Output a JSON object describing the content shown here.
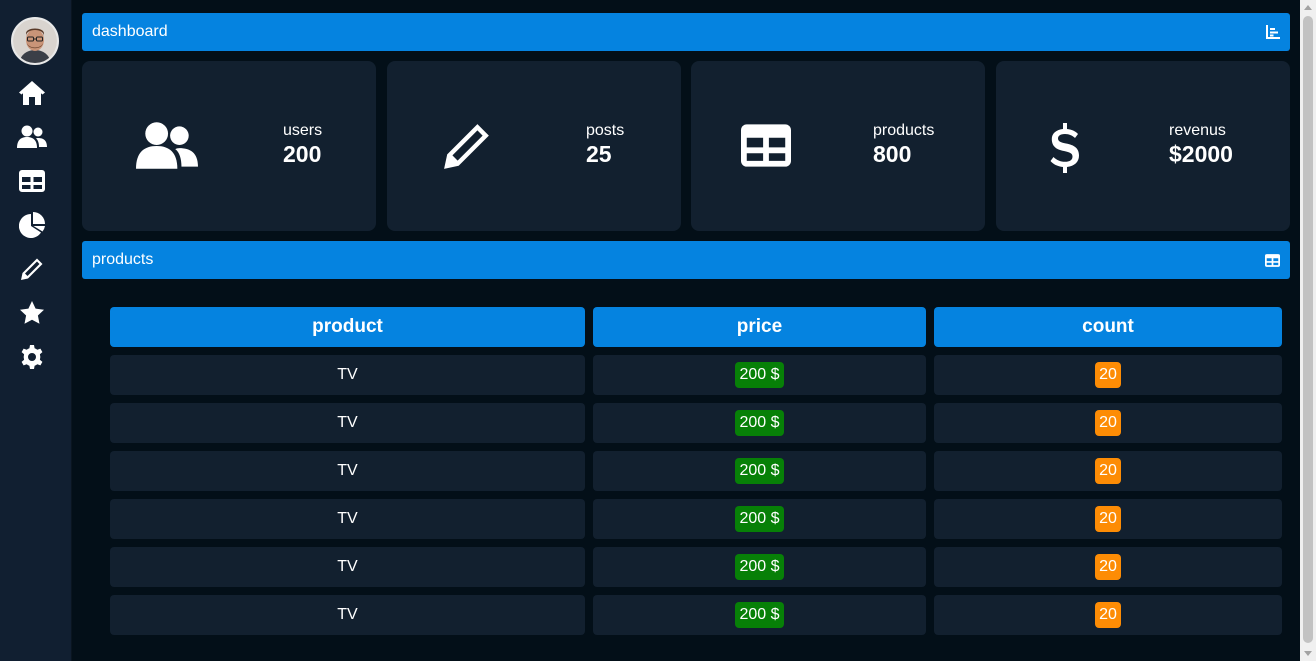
{
  "sidebar": {
    "avatar": "user-avatar",
    "items": [
      {
        "icon": "home-icon"
      },
      {
        "icon": "users-icon"
      },
      {
        "icon": "table-icon"
      },
      {
        "icon": "pie-chart-icon"
      },
      {
        "icon": "pencil-icon"
      },
      {
        "icon": "star-icon"
      },
      {
        "icon": "gear-icon"
      }
    ]
  },
  "dashboard_bar": {
    "title": "dashboard",
    "icon": "bar-chart-icon"
  },
  "stats": [
    {
      "label": "users",
      "value": "200",
      "icon": "users-icon"
    },
    {
      "label": "posts",
      "value": "25",
      "icon": "pencil-icon"
    },
    {
      "label": "products",
      "value": "800",
      "icon": "table-icon"
    },
    {
      "label": "revenus",
      "value": "$2000",
      "icon": "dollar-icon"
    }
  ],
  "products_bar": {
    "title": "products",
    "icon": "table-icon"
  },
  "table": {
    "headers": [
      "product",
      "price",
      "count"
    ],
    "rows": [
      {
        "product": "TV",
        "price": "200 $",
        "count": "20"
      },
      {
        "product": "TV",
        "price": "200 $",
        "count": "20"
      },
      {
        "product": "TV",
        "price": "200 $",
        "count": "20"
      },
      {
        "product": "TV",
        "price": "200 $",
        "count": "20"
      },
      {
        "product": "TV",
        "price": "200 $",
        "count": "20"
      },
      {
        "product": "TV",
        "price": "200 $",
        "count": "20"
      }
    ]
  },
  "colors": {
    "accent": "#0583e0",
    "card": "#12202f",
    "background": "#030f18",
    "price_badge": "#078007",
    "count_badge": "#fd8c05"
  }
}
